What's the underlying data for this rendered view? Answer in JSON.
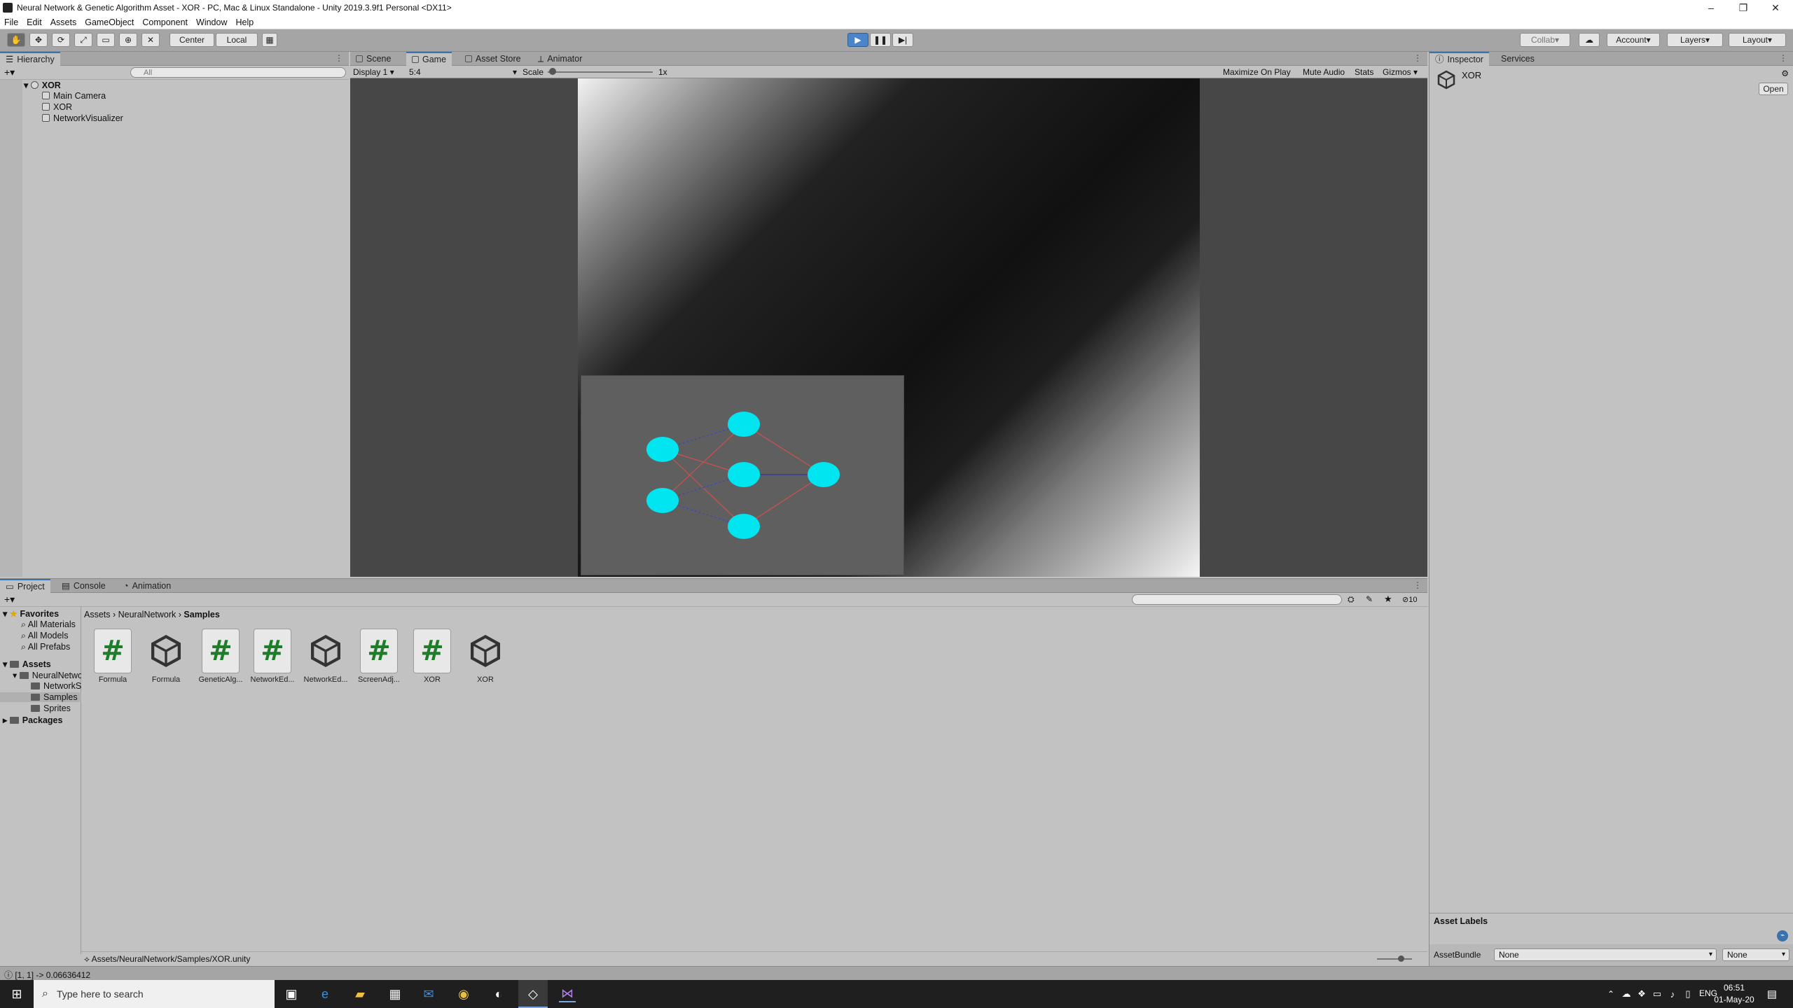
{
  "window": {
    "title": "Neural Network & Genetic Algorithm Asset - XOR - PC, Mac & Linux Standalone - Unity 2019.3.9f1 Personal <DX11>"
  },
  "menu": [
    "File",
    "Edit",
    "Assets",
    "GameObject",
    "Component",
    "Window",
    "Help"
  ],
  "toolbar": {
    "pivot": "Center",
    "space": "Local",
    "collab": "Collab",
    "account": "Account",
    "layers": "Layers",
    "layout": "Layout"
  },
  "hierarchy": {
    "tab": "Hierarchy",
    "search_placeholder": "All",
    "scene": "XOR",
    "items": [
      "Main Camera",
      "XOR",
      "NetworkVisualizer"
    ]
  },
  "center_tabs": [
    "Scene",
    "Game",
    "Asset Store",
    "Animator"
  ],
  "game_bar": {
    "display": "Display 1",
    "aspect": "5:4",
    "scale_label": "Scale",
    "scale_value": "1x",
    "maximize": "Maximize On Play",
    "mute": "Mute Audio",
    "stats": "Stats",
    "gizmos": "Gizmos"
  },
  "inspector": {
    "tabs": [
      "Inspector",
      "Services"
    ],
    "object": "XOR",
    "open_button": "Open",
    "asset_labels": "Asset Labels",
    "asset_bundle_label": "AssetBundle",
    "asset_bundle_value": "None",
    "asset_bundle_variant": "None"
  },
  "bottom_tabs": [
    "Project",
    "Console",
    "Animation"
  ],
  "project": {
    "hidden_count": "10",
    "favorites_label": "Favorites",
    "favorites": [
      "All Materials",
      "All Models",
      "All Prefabs"
    ],
    "assets_label": "Assets",
    "tree": [
      "NeuralNetwork",
      "NetworkS",
      "Samples",
      "Sprites"
    ],
    "packages_label": "Packages",
    "breadcrumb": [
      "Assets",
      "NeuralNetwork",
      "Samples"
    ],
    "tiles": [
      {
        "label": "Formula",
        "kind": "script"
      },
      {
        "label": "Formula",
        "kind": "scene"
      },
      {
        "label": "GeneticAlg...",
        "kind": "script"
      },
      {
        "label": "NetworkEd...",
        "kind": "script"
      },
      {
        "label": "NetworkEd...",
        "kind": "scene"
      },
      {
        "label": "ScreenAdj...",
        "kind": "script"
      },
      {
        "label": "XOR",
        "kind": "script"
      },
      {
        "label": "XOR",
        "kind": "scene"
      }
    ],
    "path": "Assets/NeuralNetwork/Samples/XOR.unity"
  },
  "status_bar": "[1, 1] -> 0.06636412",
  "taskbar": {
    "search_placeholder": "Type here to search",
    "lang": "ENG",
    "time": "06:51",
    "date": "01-May-20"
  },
  "colors": {
    "accent": "#3a72b0",
    "node": "#00e5ef",
    "script_hash": "#1e7c2b"
  }
}
